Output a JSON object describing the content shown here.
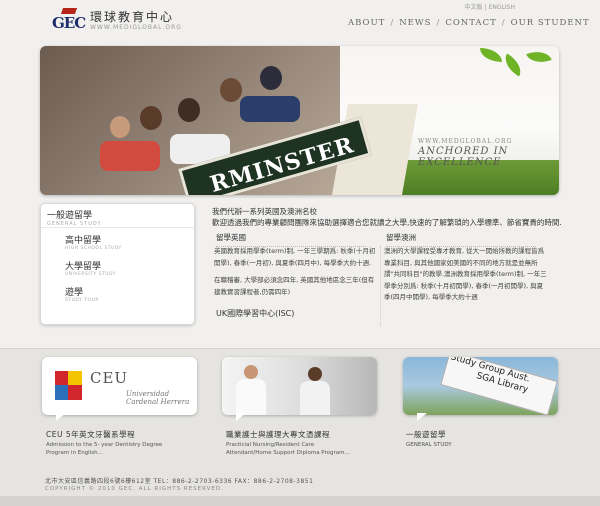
{
  "header": {
    "logo_letters": "GEC",
    "logo_title": "環球教育中心",
    "logo_url": "WWW.MEDIGLOBAL.ORG",
    "lang_zh": "中文版",
    "lang_sep": "|",
    "lang_en": "ENGLISH",
    "nav": [
      "ABOUT",
      "NEWS",
      "CONTACT",
      "OUR STUDENT"
    ],
    "nav_sep": "/"
  },
  "hero": {
    "sign_text": "RMINSTER",
    "url": "WWW.MEDGLOBAL.ORG",
    "tagline": "ANCHORED IN EXCELLENCE"
  },
  "sidebar": {
    "title": "一般遊留學",
    "subtitle": "GENERAL STUDY",
    "items": [
      {
        "label": "高中留學",
        "sub": "HIGH SCHOOL STUDY"
      },
      {
        "label": "大學留學",
        "sub": "UNIVERSITY STUDY"
      },
      {
        "label": "遊學",
        "sub": "STUDY TOUR"
      }
    ]
  },
  "main": {
    "intro_1": "我們代辦一系列英國及澳洲名校",
    "intro_2": "歡迎透過我們的專業顧問團隊來協助選擇適合您就讀之大學,快速的了解繁瑣的入學標準、節省寶貴的時間.",
    "uk_title": "留學英國",
    "au_title": "留學澳洲",
    "uk_text": "英國教育採用學季(term)制, 一年三學期爲: 秋季(十月初開學), 春季(一月初), 與夏季(四月中), 每學季大約十週.",
    "uk_text2": "在職稽審, 大學部必須念四年, 英國其他地區念三年(但有建教實習課程者,仍需四年)",
    "au_text": "澳洲的大學課程受專才教育, 從大一開始所教的課程皆爲專業科目, 與其他國家如美國的不同的地方就是並無所謂\"共同科目\"的教學.澳洲教育採用學季(term)制, 一年三學季分別爲: 秋季(十月初開學), 春季(一月初開學), 與夏季(四月中開學), 每學季大約十週",
    "isc": "UK國際學習中心(ISC)"
  },
  "cards": [
    {
      "logo_main": "CEU",
      "logo_sub1": "Universidad",
      "logo_sub2": "Cardenal Herrera",
      "title": "CEU 5年英文牙醫系學程",
      "desc1": "Admission to the 5- year Dentistry Degree",
      "desc2": "Program in English..."
    },
    {
      "title": "職業護士與護理大專文憑課程",
      "desc1": "Practicial Nursing/Resident Care",
      "desc2": "Attendant/Home Support Diploma Program..."
    },
    {
      "sign_1": "Study Group Aust.",
      "sign_2": "SGA Library",
      "title": "一般遊留學",
      "desc1": "GENERAL STUDY"
    }
  ],
  "footer": {
    "address": "北市大安區信義路四段6號6樓612室  TEL：886-2-2703-6336  FAX：886-2-2708-3851",
    "copyright": "COPYRIGHT © 2010 GEC. ALL RIGHTS RESERVED."
  },
  "colors": {
    "brand_red": "#b7241c",
    "brand_navy": "#1d2e6b",
    "page_bg": "#f1f0ee"
  }
}
